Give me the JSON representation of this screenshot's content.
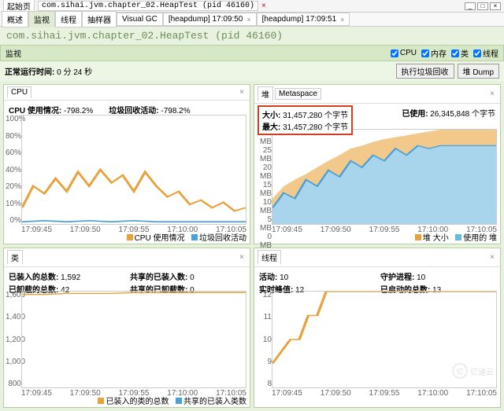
{
  "window": {
    "start_tab": "起始页",
    "main_tab": "com.sihai.jvm.chapter_02.HeapTest (pid 46160)",
    "min": "_",
    "max": "□",
    "close": "×"
  },
  "toolbar": {
    "tabs": [
      "概述",
      "监视",
      "线程",
      "抽样器",
      "Visual GC"
    ],
    "heapdump1": "[heapdump] 17:09:50",
    "heapdump2": "[heapdump] 17:09:51",
    "x": "×"
  },
  "title": "com.sihai.jvm.chapter_02.HeapTest (pid 46160)",
  "section": {
    "label": "监视",
    "cpu": "CPU",
    "mem": "内存",
    "cls": "类",
    "thr": "线程"
  },
  "runtime": {
    "label": "正常运行时间:",
    "value": "0 分 24 秒"
  },
  "buttons": {
    "gc": "执行垃圾回收",
    "dump": "堆 Dump"
  },
  "cpu_panel": {
    "tab": "CPU",
    "usage_lbl": "CPU 使用情况:",
    "usage_val": "-798.2%",
    "gc_lbl": "垃圾回收活动:",
    "gc_val": "-798.2%",
    "legend1": "CPU 使用情况",
    "legend2": "垃圾回收活动"
  },
  "heap_panel": {
    "tab1": "堆",
    "tab2": "Metaspace",
    "size_lbl": "大小:",
    "size_val": "31,457,280 个字节",
    "max_lbl": "最大:",
    "max_val": "31,457,280 个字节",
    "used_lbl": "已使用:",
    "used_val": "26,345,848 个字节",
    "legend1": "堆 大小",
    "legend2": "使用的 堆"
  },
  "cls_panel": {
    "tab": "类",
    "loaded_lbl": "已装入的总数:",
    "loaded_val": "1,592",
    "unloaded_lbl": "已卸载的总数:",
    "unloaded_val": "42",
    "shared_lbl": "共享的已装入数:",
    "shared_val": "0",
    "shared_un_lbl": "共享的已卸载数:",
    "shared_un_val": "0",
    "legend1": "已装入的类的总数",
    "legend2": "共享的已装入类数"
  },
  "thr_panel": {
    "tab": "线程",
    "live_lbl": "活动:",
    "live_val": "10",
    "daemon_lbl": "守护进程:",
    "daemon_val": "10",
    "peak_lbl": "实时峰值:",
    "peak_val": "12",
    "started_lbl": "已启动的总数:",
    "started_val": "13"
  },
  "xticks": [
    "17:09:45",
    "17:09:50",
    "17:09:55",
    "17:10:00",
    "17:10:05"
  ],
  "watermark": "亿速云",
  "chart_data": [
    {
      "type": "line",
      "title": "CPU",
      "x": [
        "17:09:45",
        "17:09:50",
        "17:09:55",
        "17:10:00",
        "17:10:05"
      ],
      "ylim": [
        0,
        100
      ],
      "yticks": [
        0,
        10,
        20,
        40,
        60,
        80,
        100
      ],
      "series": [
        {
          "name": "CPU 使用情况",
          "color": "#e8a23c",
          "values": [
            15,
            35,
            28,
            42,
            30,
            48,
            35,
            50,
            38,
            45,
            30,
            48,
            35,
            25,
            30,
            18,
            22,
            15,
            20,
            12
          ]
        },
        {
          "name": "垃圾回收活动",
          "color": "#4aa0d8",
          "values": [
            2,
            3,
            2,
            4,
            2,
            3,
            2,
            3,
            2,
            3,
            2,
            3,
            2,
            2,
            2,
            2,
            2,
            2,
            2,
            2
          ]
        }
      ]
    },
    {
      "type": "area",
      "title": "堆",
      "x": [
        "17:09:45",
        "17:09:50",
        "17:09:55",
        "17:10:00",
        "17:10:05"
      ],
      "ylim": [
        0,
        30
      ],
      "yticks": [
        "0 MB",
        "5 MB",
        "10 MB",
        "15 MB",
        "20 MB",
        "25 MB",
        "30 MB"
      ],
      "series": [
        {
          "name": "堆 大小",
          "color": "#e8a23c",
          "values": [
            8,
            12,
            14,
            16,
            18,
            20,
            22,
            24,
            25,
            26,
            27,
            28,
            28,
            29,
            29,
            30,
            30,
            30,
            30,
            30
          ]
        },
        {
          "name": "使用的 堆",
          "color": "#6ab8e0",
          "values": [
            5,
            10,
            8,
            14,
            12,
            17,
            15,
            20,
            18,
            22,
            20,
            24,
            22,
            25,
            24,
            25,
            25,
            25,
            25,
            25
          ]
        }
      ]
    },
    {
      "type": "line",
      "title": "类",
      "x": [
        "17:09:45",
        "17:09:50",
        "17:09:55",
        "17:10:00",
        "17:10:05"
      ],
      "ylim": [
        800,
        1600
      ],
      "yticks": [
        "800",
        "1,000",
        "1,200",
        "1,400",
        "1,600"
      ],
      "series": [
        {
          "name": "已装入的类的总数",
          "color": "#e8a23c",
          "values": [
            1580,
            1582,
            1585,
            1586,
            1588,
            1589,
            1590,
            1590,
            1591,
            1591,
            1592,
            1592,
            1592,
            1592,
            1592,
            1592,
            1592,
            1592,
            1592,
            1592
          ]
        },
        {
          "name": "共享的已装入类数",
          "color": "#4aa0d8",
          "values": [
            0,
            0,
            0,
            0,
            0,
            0,
            0,
            0,
            0,
            0,
            0,
            0,
            0,
            0,
            0,
            0,
            0,
            0,
            0,
            0
          ]
        }
      ]
    },
    {
      "type": "line",
      "title": "线程",
      "x": [
        "17:09:45",
        "17:09:50",
        "17:09:55",
        "17:10:00",
        "17:10:05"
      ],
      "ylim": [
        8,
        12
      ],
      "yticks": [
        "8",
        "9",
        "10",
        "11",
        "12"
      ],
      "series": [
        {
          "name": "活动",
          "color": "#e8a23c",
          "values": [
            9,
            10,
            10,
            11,
            11,
            12,
            12,
            12,
            12,
            12,
            12,
            12,
            12,
            12,
            12,
            12,
            12,
            12,
            12,
            12
          ]
        }
      ]
    }
  ]
}
